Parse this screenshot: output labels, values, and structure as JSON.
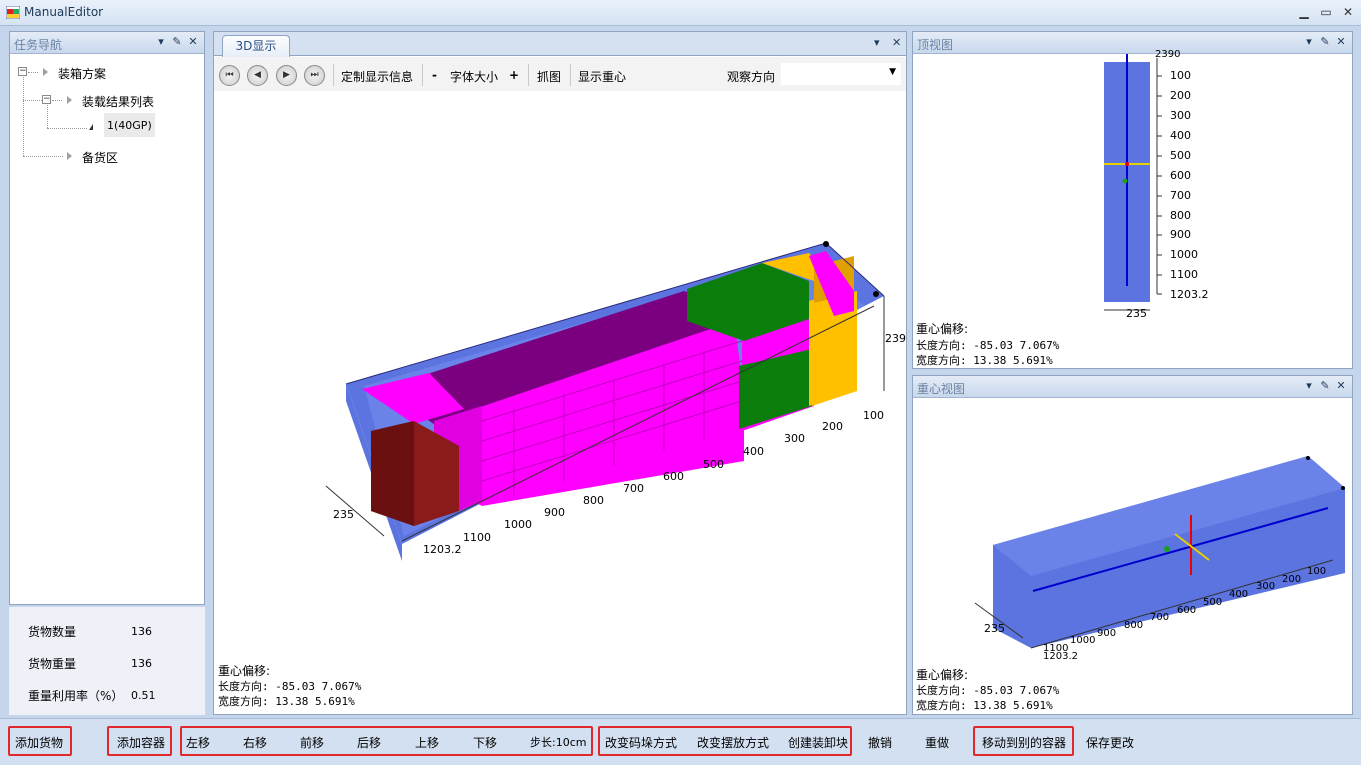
{
  "window": {
    "title": "ManualEditor",
    "min_label": "▁",
    "max_label": "▭",
    "close_label": "✕"
  },
  "nav_panel": {
    "title": "任务导航",
    "tree": {
      "root": "装箱方案",
      "results": "装载结果列表",
      "container": "1(40GP)",
      "reserve": "备货区"
    },
    "stats": [
      {
        "label": "货物数量",
        "value": "136"
      },
      {
        "label": "货物重量",
        "value": "136"
      },
      {
        "label": "重量利用率（%）",
        "value": "0.51"
      }
    ]
  },
  "view3d": {
    "tab": "3D显示",
    "toolbar": {
      "custom_info": "定制显示信息",
      "font_minus": "-",
      "font_size": "字体大小",
      "font_plus": "+",
      "capture": "抓图",
      "show_cg": "显示重心",
      "view_dir": "观察方向",
      "view_dir_value": ""
    },
    "axis_labels": [
      "100",
      "200",
      "300",
      "400",
      "500",
      "600",
      "700",
      "800",
      "900",
      "1000",
      "1100",
      "1203.2"
    ],
    "height_label": "239",
    "width_label": "235",
    "cg": {
      "heading": "重心偏移:",
      "length_line": "长度方向: -85.03  7.067%",
      "width_line": "宽度方向: 13.38  5.691%"
    }
  },
  "top_view": {
    "title": "顶视图",
    "ruler": [
      "100",
      "200",
      "300",
      "400",
      "500",
      "600",
      "700",
      "800",
      "900",
      "1000",
      "1100",
      "1203.2"
    ],
    "ruler_top": "2390",
    "width_label": "235",
    "cg": {
      "heading": "重心偏移:",
      "length_line": "长度方向: -85.03  7.067%",
      "width_line": "宽度方向: 13.38  5.691%"
    }
  },
  "cg_view": {
    "title": "重心视图",
    "axis_labels": [
      "100",
      "200",
      "300",
      "400",
      "500",
      "600",
      "700",
      "800",
      "900",
      "1000",
      "1100",
      "1203.2"
    ],
    "width_label": "235",
    "cg": {
      "heading": "重心偏移:",
      "length_line": "长度方向: -85.03  7.067%",
      "width_line": "宽度方向: 13.38  5.691%"
    }
  },
  "bottom_toolbar": {
    "add_cargo": "添加货物",
    "add_container": "添加容器",
    "left": "左移",
    "right": "右移",
    "forward": "前移",
    "back": "后移",
    "up": "上移",
    "down": "下移",
    "step": "步长:10cm",
    "change_stack": "改变码垛方式",
    "change_place": "改变摆放方式",
    "create_block": "创建装卸块",
    "undo": "撤销",
    "redo": "重做",
    "move_to_container": "移动到别的容器",
    "save": "保存更改"
  },
  "colors": {
    "container_blue": "#5b74e0",
    "magenta": "#f0f",
    "purple": "#7a0080",
    "green": "#0a7d0a",
    "gold": "#ffc000",
    "brown": "#8b1a1a",
    "highlight_red": "#e0282d"
  }
}
